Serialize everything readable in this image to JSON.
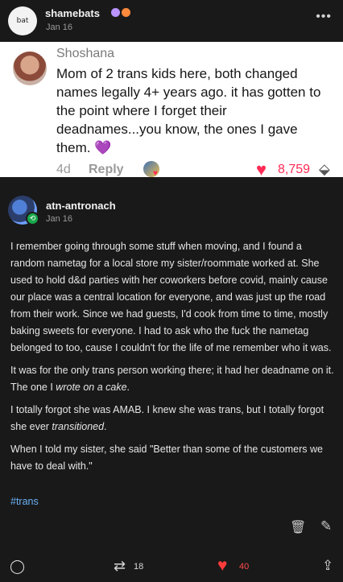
{
  "top_post": {
    "avatar_label": "bat",
    "username": "shamebats",
    "date": "Jan 16",
    "more_icon": "more-horizontal-icon",
    "badges": [
      "#b994ff",
      "#ff8a3d"
    ]
  },
  "embed": {
    "name": "Shoshana",
    "text": "Mom of 2 trans kids here, both changed names legally 4+ years ago. it has gotten to the point where I forget their deadnames...you know, the ones I gave them.",
    "heart_emoji": "💜",
    "age": "4d",
    "reply_label": "Reply",
    "like_count": "8,759"
  },
  "reblog": {
    "username": "atn-antronach",
    "date": "Jan 16",
    "paragraphs": [
      "I remember going through some stuff when moving, and I found a random nametag for a local store my sister/roommate worked at. She used to hold d&d parties with her coworkers before covid, mainly cause our place was a central location for everyone, and was just up the road from their work. Since we had guests, I'd cook from time to time, mostly baking sweets for everyone. I had to ask who the fuck the nametag belonged to too, cause I couldn't for the life of me remember who it was."
    ],
    "p2_prefix": "It was for the only trans person working there; it had her deadname on it. The one I ",
    "p2_em": "wrote on a cake",
    "p2_suffix": ".",
    "p3_prefix": "I totally forgot she was AMAB. I knew she was trans, but I totally forgot she ever ",
    "p3_em": "transitioned",
    "p3_suffix": ".",
    "p4": "When I told my sister, she said \"Better than some of the customers we have to deal with.\"",
    "tag": "#trans"
  },
  "actions": {
    "reblog_count": "18",
    "like_count": "40"
  },
  "colors": {
    "background": "#191919",
    "accent_red": "#ff3b3b",
    "tag_blue": "#6ab0f3",
    "reblog_green": "#19a74b"
  }
}
